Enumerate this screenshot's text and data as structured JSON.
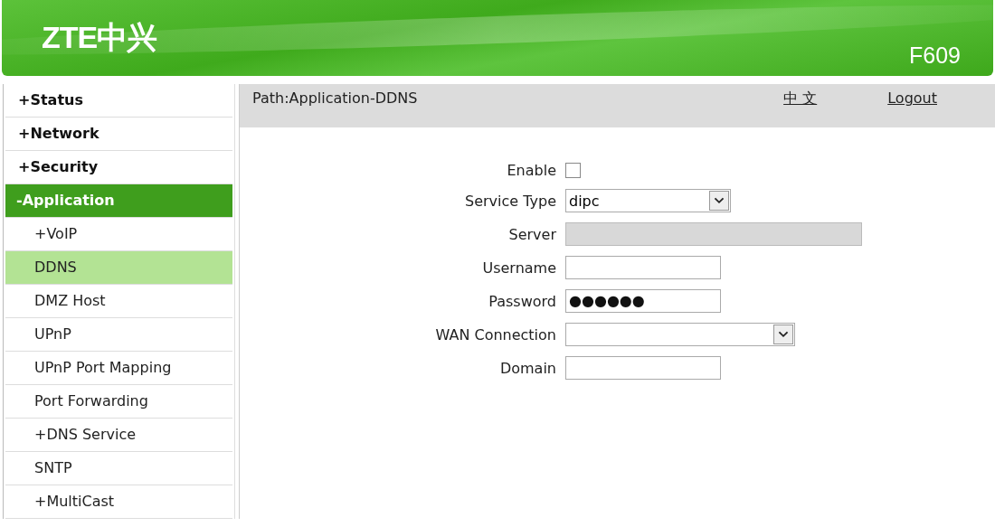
{
  "header": {
    "logo": "ZTE中兴",
    "model": "F609"
  },
  "sidebar": {
    "items": [
      {
        "label": "+Status",
        "open": false
      },
      {
        "label": "+Network",
        "open": false
      },
      {
        "label": "+Security",
        "open": false
      },
      {
        "label": "-Application",
        "open": true,
        "children": [
          {
            "label": "+VoIP",
            "selected": false
          },
          {
            "label": "DDNS",
            "selected": true
          },
          {
            "label": "DMZ Host",
            "selected": false
          },
          {
            "label": "UPnP",
            "selected": false
          },
          {
            "label": "UPnP Port Mapping",
            "selected": false
          },
          {
            "label": "Port Forwarding",
            "selected": false
          },
          {
            "label": "+DNS Service",
            "selected": false
          },
          {
            "label": "SNTP",
            "selected": false
          },
          {
            "label": "+MultiCast",
            "selected": false
          }
        ]
      }
    ]
  },
  "path_bar": {
    "path": "Path:Application-DDNS",
    "language_link": "中 文",
    "logout_link": "Logout"
  },
  "form": {
    "fields": [
      {
        "label": "Enable",
        "kind": "checkbox",
        "checked": false
      },
      {
        "label": "Service Type",
        "kind": "select",
        "value": "dipc",
        "wide": false
      },
      {
        "label": "Server",
        "kind": "text",
        "disabled": true
      },
      {
        "label": "Username",
        "kind": "text",
        "disabled": false
      },
      {
        "label": "Password",
        "kind": "text",
        "value": "●●●●●●",
        "disabled": false
      },
      {
        "label": "WAN Connection",
        "kind": "select",
        "wide": true
      },
      {
        "label": "Domain",
        "kind": "text",
        "disabled": false
      }
    ]
  }
}
